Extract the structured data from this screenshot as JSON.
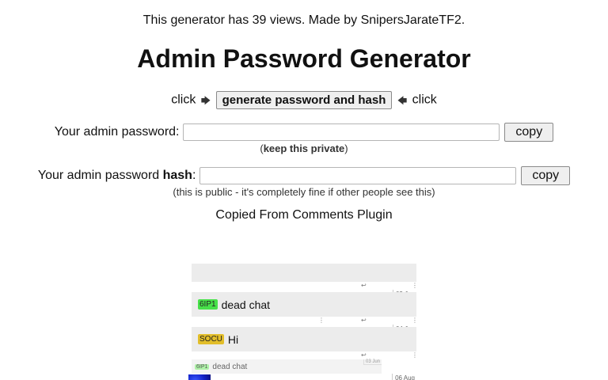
{
  "header": {
    "views_text": "This generator has 39 views. Made by SnipersJarateTF2.",
    "title": "Admin Password Generator"
  },
  "generator": {
    "click_left": "click",
    "button_label": "generate password and hash",
    "click_right": "click",
    "arrow_left": "🡆",
    "arrow_right": "🡄"
  },
  "password": {
    "label": "Your admin password:",
    "value": "",
    "copy_label": "copy",
    "hint_open": "(",
    "hint_bold": "keep this private",
    "hint_close": ")"
  },
  "hash": {
    "label_prefix": "Your admin password ",
    "label_bold": "hash",
    "label_suffix": ":",
    "value": "",
    "copy_label": "copy",
    "hint": "(this is public - it's completely fine if other people see this)"
  },
  "copied_text": "Copied From Comments Plugin",
  "comments": [
    {
      "tag": "6IP1",
      "tag_color": "#48e14a",
      "text": "dead chat",
      "date": "03 Jun"
    },
    {
      "tag": "SOCU",
      "tag_color": "#e2be2a",
      "text": "Hi",
      "date": "04 Jun"
    }
  ],
  "nested_reply": {
    "tag": "6IP1",
    "text": "dead chat",
    "date": "03 Jun"
  },
  "last_date": "06 Aug",
  "icons": {
    "reply": "↩",
    "options": "⋮"
  }
}
